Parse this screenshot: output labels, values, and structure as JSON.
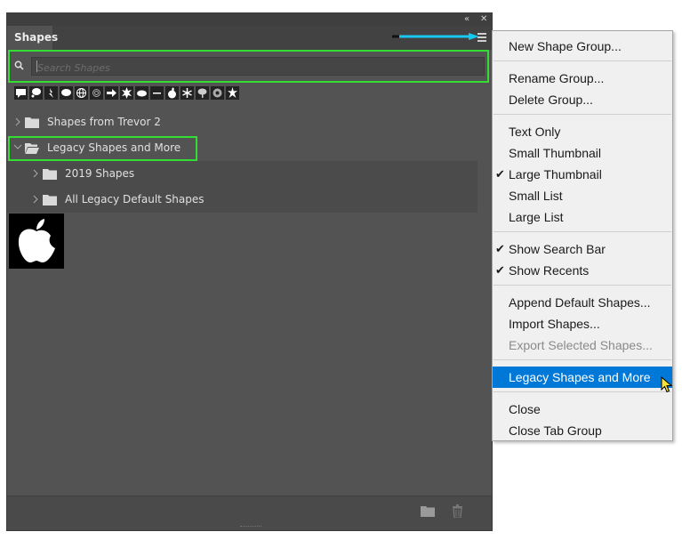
{
  "panel": {
    "tab_title": "Shapes",
    "collapse_icon": "double-chevron-left",
    "close_icon": "close-x",
    "menu_icon": "hamburger",
    "search_placeholder": "Search Shapes",
    "recent_shapes": [
      "speech-bubble",
      "thought-bubble",
      "lightning",
      "oval-bubble",
      "globe",
      "fingerprint",
      "arrow",
      "starburst",
      "cloud",
      "dash",
      "apple",
      "snowflake",
      "tree",
      "circle-badge",
      "starburst-2"
    ],
    "groups": [
      {
        "label": "Shapes from Trevor 2",
        "expanded": false
      },
      {
        "label": "Legacy Shapes and More",
        "expanded": true
      },
      {
        "label": "2019 Shapes",
        "expanded": false
      },
      {
        "label": "All Legacy Default Shapes",
        "expanded": false
      }
    ],
    "footer_icons": [
      "new-group-folder",
      "trash"
    ]
  },
  "menu": {
    "items": [
      {
        "label": "New Shape Group..."
      },
      {
        "label": "Rename Group..."
      },
      {
        "label": "Delete Group..."
      },
      {
        "label": "Text Only"
      },
      {
        "label": "Small Thumbnail"
      },
      {
        "label": "Large Thumbnail",
        "checked": true
      },
      {
        "label": "Small List"
      },
      {
        "label": "Large List"
      },
      {
        "label": "Show Search Bar",
        "checked": true
      },
      {
        "label": "Show Recents",
        "checked": true
      },
      {
        "label": "Append Default Shapes..."
      },
      {
        "label": "Import Shapes..."
      },
      {
        "label": "Export Selected Shapes...",
        "disabled": true
      },
      {
        "label": "Legacy Shapes and More",
        "highlighted": true
      },
      {
        "label": "Close"
      },
      {
        "label": "Close Tab Group"
      }
    ]
  },
  "colors": {
    "highlight": "#0078d7",
    "annotation_green": "#33dd33",
    "annotation_arrow": "#19c8f0"
  }
}
